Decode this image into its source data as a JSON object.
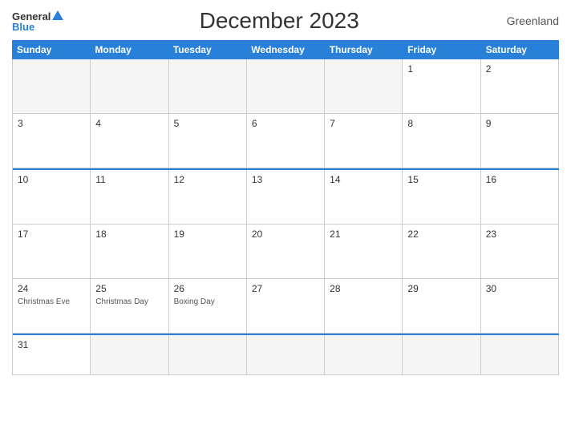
{
  "header": {
    "logo_general": "General",
    "logo_blue": "Blue",
    "title": "December 2023",
    "region": "Greenland"
  },
  "days_of_week": [
    "Sunday",
    "Monday",
    "Tuesday",
    "Wednesday",
    "Thursday",
    "Friday",
    "Saturday"
  ],
  "weeks": [
    {
      "blue_top": false,
      "cells": [
        {
          "date": "",
          "holiday": "",
          "empty": true
        },
        {
          "date": "",
          "holiday": "",
          "empty": true
        },
        {
          "date": "",
          "holiday": "",
          "empty": true
        },
        {
          "date": "",
          "holiday": "",
          "empty": true
        },
        {
          "date": "",
          "holiday": "",
          "empty": true
        },
        {
          "date": "1",
          "holiday": "",
          "empty": false
        },
        {
          "date": "2",
          "holiday": "",
          "empty": false
        }
      ]
    },
    {
      "blue_top": false,
      "cells": [
        {
          "date": "3",
          "holiday": "",
          "empty": false
        },
        {
          "date": "4",
          "holiday": "",
          "empty": false
        },
        {
          "date": "5",
          "holiday": "",
          "empty": false
        },
        {
          "date": "6",
          "holiday": "",
          "empty": false
        },
        {
          "date": "7",
          "holiday": "",
          "empty": false
        },
        {
          "date": "8",
          "holiday": "",
          "empty": false
        },
        {
          "date": "9",
          "holiday": "",
          "empty": false
        }
      ]
    },
    {
      "blue_top": true,
      "cells": [
        {
          "date": "10",
          "holiday": "",
          "empty": false
        },
        {
          "date": "11",
          "holiday": "",
          "empty": false
        },
        {
          "date": "12",
          "holiday": "",
          "empty": false
        },
        {
          "date": "13",
          "holiday": "",
          "empty": false
        },
        {
          "date": "14",
          "holiday": "",
          "empty": false
        },
        {
          "date": "15",
          "holiday": "",
          "empty": false
        },
        {
          "date": "16",
          "holiday": "",
          "empty": false
        }
      ]
    },
    {
      "blue_top": false,
      "cells": [
        {
          "date": "17",
          "holiday": "",
          "empty": false
        },
        {
          "date": "18",
          "holiday": "",
          "empty": false
        },
        {
          "date": "19",
          "holiday": "",
          "empty": false
        },
        {
          "date": "20",
          "holiday": "",
          "empty": false
        },
        {
          "date": "21",
          "holiday": "",
          "empty": false
        },
        {
          "date": "22",
          "holiday": "",
          "empty": false
        },
        {
          "date": "23",
          "holiday": "",
          "empty": false
        }
      ]
    },
    {
      "blue_top": false,
      "cells": [
        {
          "date": "24",
          "holiday": "Christmas Eve",
          "empty": false
        },
        {
          "date": "25",
          "holiday": "Christmas Day",
          "empty": false
        },
        {
          "date": "26",
          "holiday": "Boxing Day",
          "empty": false
        },
        {
          "date": "27",
          "holiday": "",
          "empty": false
        },
        {
          "date": "28",
          "holiday": "",
          "empty": false
        },
        {
          "date": "29",
          "holiday": "",
          "empty": false
        },
        {
          "date": "30",
          "holiday": "",
          "empty": false
        }
      ]
    },
    {
      "blue_top": true,
      "last": true,
      "cells": [
        {
          "date": "31",
          "holiday": "",
          "empty": false
        },
        {
          "date": "",
          "holiday": "",
          "empty": true
        },
        {
          "date": "",
          "holiday": "",
          "empty": true
        },
        {
          "date": "",
          "holiday": "",
          "empty": true
        },
        {
          "date": "",
          "holiday": "",
          "empty": true
        },
        {
          "date": "",
          "holiday": "",
          "empty": true
        },
        {
          "date": "",
          "holiday": "",
          "empty": true
        }
      ]
    }
  ]
}
